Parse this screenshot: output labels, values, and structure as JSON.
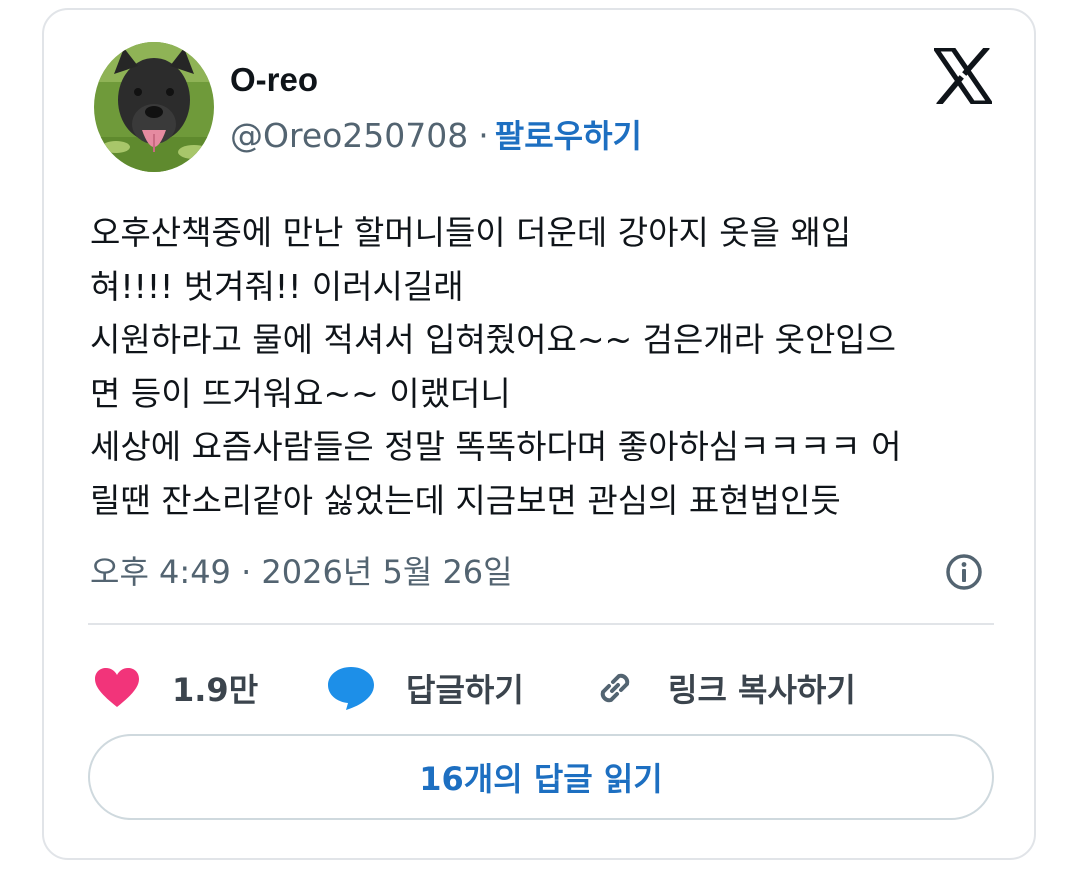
{
  "author": {
    "display_name": "O-reo",
    "handle": "@Oreo250708",
    "separator": "·",
    "follow_label": "팔로우하기",
    "avatar_icon": "dog-photo-avatar"
  },
  "platform_icon": "x-logo-icon",
  "tweet": {
    "lines": [
      "오후산책중에 만난 할머니들이 더운데 강아지 옷을 왜입",
      "혀!!!! 벗겨줘!! 이러시길래",
      "시원하라고 물에 적셔서 입혀줬어요~~ 검은개라 옷안입으",
      "면 등이 뜨거워요~~ 이랬더니",
      "세상에 요즘사람들은 정말 똑똑하다며 좋아하심ㅋㅋㅋㅋ 어",
      "릴땐 잔소리같아 싫었는데 지금보면 관심의 표현법인듯"
    ],
    "timestamp": "오후 4:49 · 2026년 5월 26일"
  },
  "actions": {
    "like_count": "1.9만",
    "reply_label": "답글하기",
    "copy_link_label": "링크 복사하기"
  },
  "read_replies_label": "16개의 답글 읽기",
  "colors": {
    "like": "#f2347a",
    "reply": "#1d8fe8",
    "link": "#1d6fc1",
    "secondary_text": "#536471",
    "border": "#e1e4e8"
  }
}
